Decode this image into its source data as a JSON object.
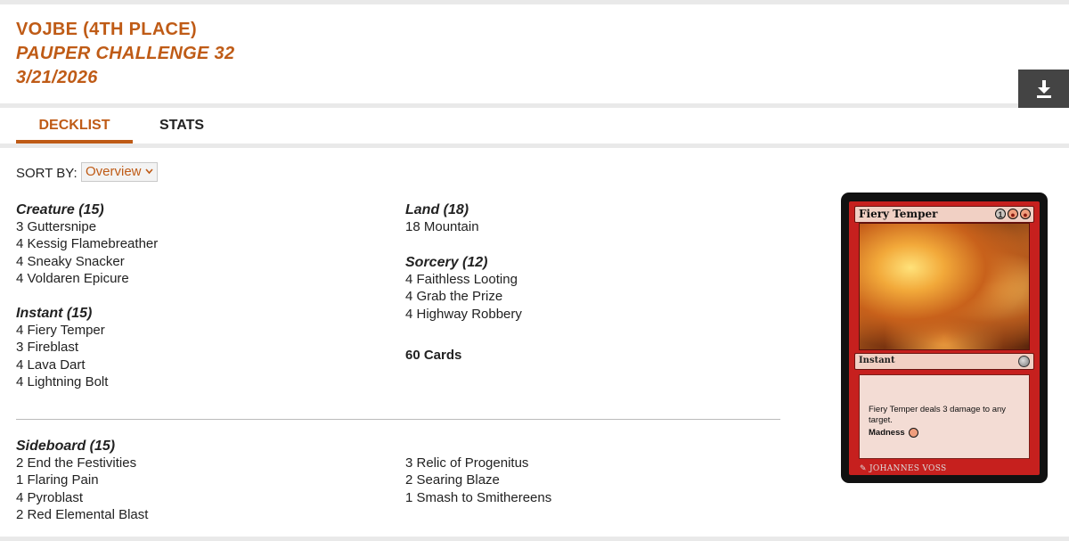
{
  "header": {
    "player": "VOJBE (4TH PLACE)",
    "event": "PAUPER CHALLENGE 32",
    "date": "3/21/2026",
    "download_icon": "download-icon"
  },
  "tabs": [
    {
      "label": "DECKLIST",
      "active": true
    },
    {
      "label": "STATS",
      "active": false
    }
  ],
  "sort": {
    "label": "SORT BY:",
    "value": "Overview"
  },
  "main_deck": {
    "creature": {
      "title": "Creature (15)",
      "cards": [
        "3 Guttersnipe",
        "4 Kessig Flamebreather",
        "4 Sneaky Snacker",
        "4 Voldaren Epicure"
      ]
    },
    "instant": {
      "title": "Instant (15)",
      "cards": [
        "4 Fiery Temper",
        "3 Fireblast",
        "4 Lava Dart",
        "4 Lightning Bolt"
      ]
    },
    "land": {
      "title": "Land (18)",
      "cards": [
        "18 Mountain"
      ]
    },
    "sorcery": {
      "title": "Sorcery (12)",
      "cards": [
        "4 Faithless Looting",
        "4 Grab the Prize",
        "4 Highway Robbery"
      ]
    },
    "total": "60 Cards"
  },
  "sideboard": {
    "title": "Sideboard (15)",
    "col1": [
      "2 End the Festivities",
      "1 Flaring Pain",
      "4 Pyroblast",
      "2 Red Elemental Blast"
    ],
    "col2": [
      "3 Relic of Progenitus",
      "2 Searing Blaze",
      "1 Smash to Smithereens"
    ]
  },
  "card_preview": {
    "name": "Fiery Temper",
    "mana": [
      "1",
      "R",
      "R"
    ],
    "type": "Instant",
    "rules": "Fiery Temper deals 3 damage to any target.",
    "keyword": "Madness",
    "artist": "JOHANNES VOSS"
  },
  "colors": {
    "accent": "#bf5b16",
    "download_bg": "#444444",
    "card_red": "#c6201e"
  }
}
